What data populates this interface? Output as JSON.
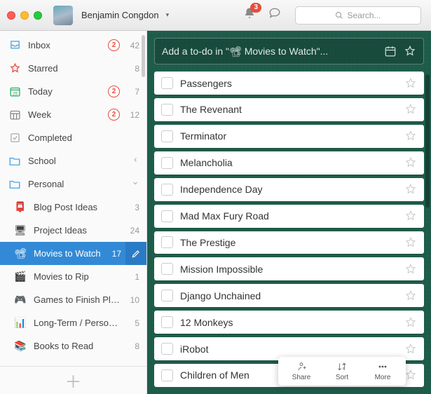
{
  "titlebar": {
    "username": "Benjamin Congdon",
    "notification_count": "3",
    "search_placeholder": "Search..."
  },
  "sidebar": {
    "smart": [
      {
        "icon": "inbox",
        "label": "Inbox",
        "badge": "2",
        "count": "42"
      },
      {
        "icon": "star",
        "label": "Starred",
        "badge": "",
        "count": "8"
      },
      {
        "icon": "today",
        "label": "Today",
        "badge": "2",
        "count": "7"
      },
      {
        "icon": "week",
        "label": "Week",
        "badge": "2",
        "count": "12"
      },
      {
        "icon": "completed",
        "label": "Completed",
        "badge": "",
        "count": ""
      }
    ],
    "folders": [
      {
        "label": "School",
        "expanded": false
      },
      {
        "label": "Personal",
        "expanded": true
      }
    ],
    "items": [
      {
        "emoji": "📮",
        "label": "Blog Post Ideas",
        "count": "3"
      },
      {
        "emoji": "🖥",
        "label": "Project Ideas",
        "count": "24"
      },
      {
        "emoji": "📽",
        "label": "Movies to Watch",
        "count": "17",
        "active": true
      },
      {
        "emoji": "🎬",
        "label": "Movies to Rip",
        "count": "1"
      },
      {
        "emoji": "🎮",
        "label": "Games to Finish Playing",
        "count": "10"
      },
      {
        "emoji": "📊",
        "label": "Long-Term / Personal...",
        "count": "5"
      },
      {
        "emoji": "📚",
        "label": "Books to Read",
        "count": "8"
      }
    ]
  },
  "add_placeholder": "Add a to-do in \"📽 Movies to Watch\"...",
  "todos": [
    "Passengers",
    "The Revenant",
    "Terminator",
    "Melancholia",
    "Independence Day",
    "Mad Max Fury Road",
    "The Prestige",
    "Mission Impossible",
    "Django Unchained",
    "12 Monkeys",
    "iRobot",
    "Children of Men"
  ],
  "toolbar": {
    "share": "Share",
    "sort": "Sort",
    "more": "More"
  }
}
